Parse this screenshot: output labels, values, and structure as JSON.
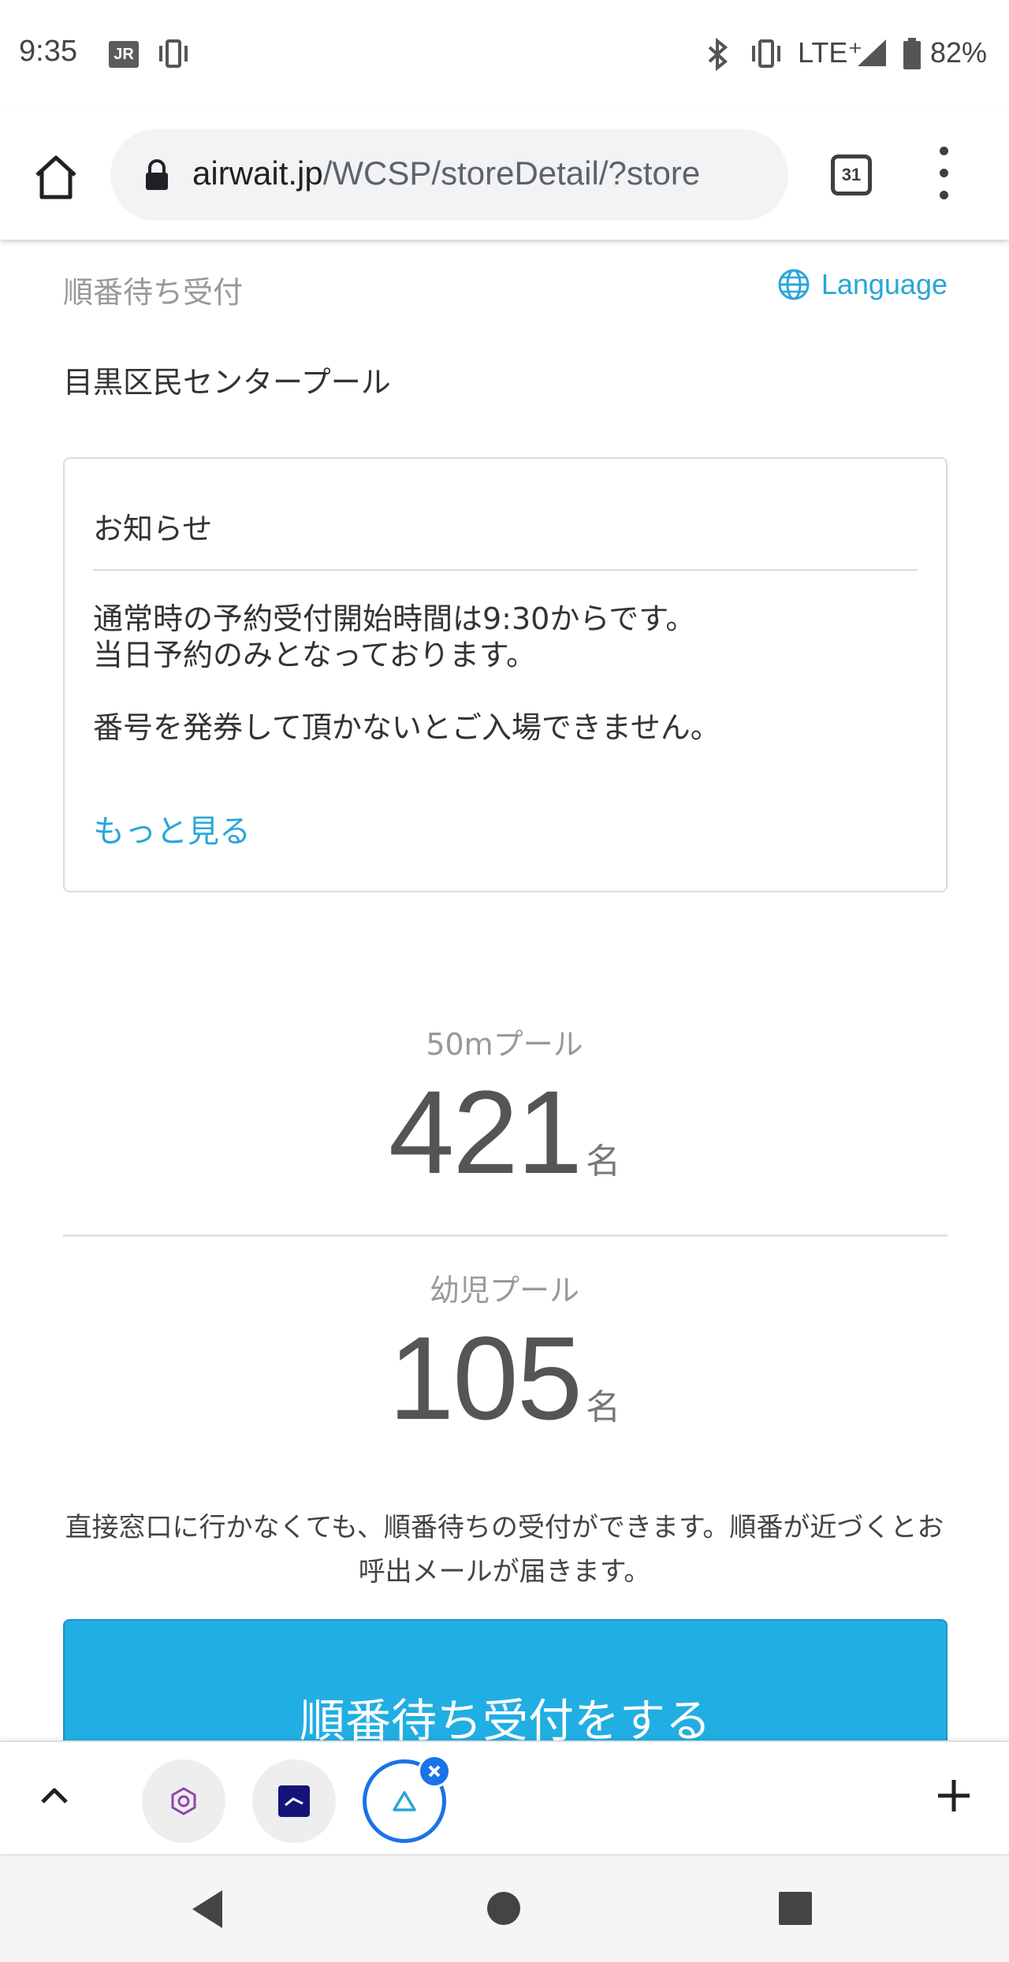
{
  "status_bar": {
    "time": "9:35",
    "jr_badge": "JR",
    "network": "LTE⁺",
    "battery": "82%",
    "icons": [
      "vibrate-icon",
      "bluetooth-icon",
      "signal-icon",
      "battery-icon"
    ]
  },
  "browser": {
    "url_domain": "airwait.jp",
    "url_path": "/WCSP/storeDetail/?store",
    "tab_count": "31"
  },
  "page": {
    "heading": "順番待ち受付",
    "language_label": "Language",
    "store_name": "目黒区民センタープール",
    "notice": {
      "title": "お知らせ",
      "lines": [
        "通常時の予約受付開始時間は9:30からです。",
        "当日予約のみとなっております。",
        "番号を発券して頂かないとご入場できません。"
      ],
      "more_label": "もっと見る"
    },
    "queues": [
      {
        "label": "50mプール",
        "count": "421",
        "unit": "名"
      },
      {
        "label": "幼児プール",
        "count": "105",
        "unit": "名"
      }
    ],
    "helper_text": "直接窓口に行かなくても、順番待ちの受付ができます。順番が近づくとお呼出メールが届きます。",
    "cta_label": "順番待ち受付をする"
  },
  "colors": {
    "accent": "#21aee3",
    "link": "#2aa6d8",
    "active_tab": "#1a73e8"
  }
}
